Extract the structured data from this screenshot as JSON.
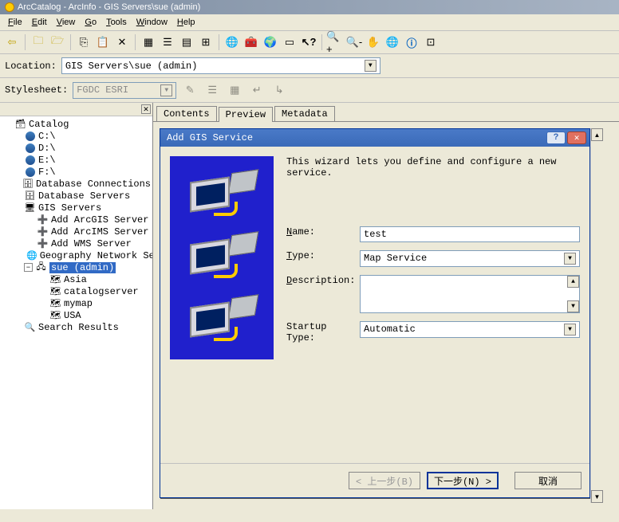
{
  "title": "ArcCatalog - ArcInfo - GIS Servers\\sue (admin)",
  "menu": {
    "file": "File",
    "edit": "Edit",
    "view": "View",
    "go": "Go",
    "tools": "Tools",
    "window": "Window",
    "help": "Help"
  },
  "location_label": "Location:",
  "location_value": "GIS Servers\\sue (admin)",
  "stylesheet_label": "Stylesheet:",
  "stylesheet_value": "FGDC ESRI",
  "tree": {
    "root": "Catalog",
    "drives": [
      "C:\\",
      "D:\\",
      "E:\\",
      "F:\\"
    ],
    "dbconn": "Database Connections",
    "dbserv": "Database Servers",
    "gis": "GIS Servers",
    "gis_items": [
      "Add ArcGIS Server",
      "Add ArcIMS Server",
      "Add WMS Server",
      "Geography Network Servic"
    ],
    "sue": "sue (admin)",
    "sue_items": [
      "Asia",
      "catalogserver",
      "mymap",
      "USA"
    ],
    "search": "Search Results"
  },
  "tabs": {
    "contents": "Contents",
    "preview": "Preview",
    "metadata": "Metadata"
  },
  "dialog": {
    "title": "Add GIS Service",
    "wiztext": "This wizard lets you define and configure a new service.",
    "name_label": "Name:",
    "name_value": "test",
    "type_label": "Type:",
    "type_value": "Map Service",
    "desc_label": "Description:",
    "startup_label": "Startup Type:",
    "startup_value": "Automatic",
    "back": "< 上一步(B)",
    "next": "下一步(N) >",
    "cancel": "取消"
  }
}
